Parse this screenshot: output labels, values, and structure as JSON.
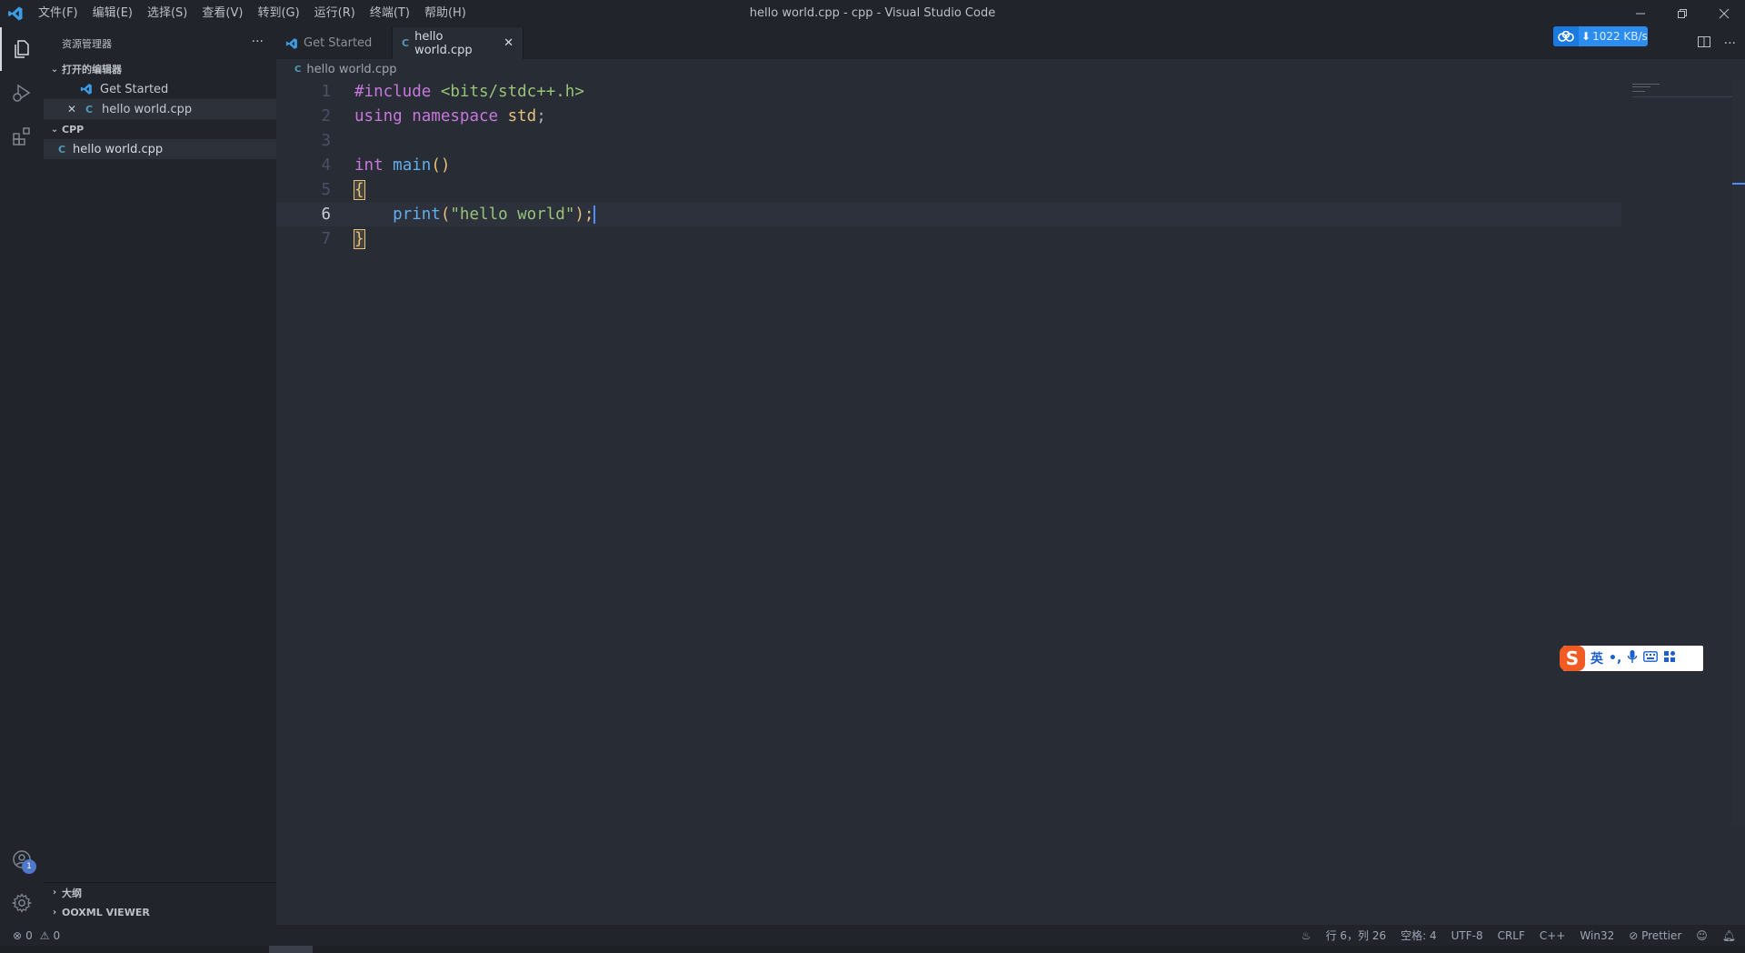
{
  "window": {
    "title": "hello world.cpp - cpp - Visual Studio Code",
    "menu": [
      "文件(F)",
      "编辑(E)",
      "选择(S)",
      "查看(V)",
      "转到(G)",
      "运行(R)",
      "终端(T)",
      "帮助(H)"
    ]
  },
  "activity_badge": "1",
  "sidebar": {
    "title": "资源管理器",
    "open_editors_title": "打开的编辑器",
    "open_editors": [
      "Get Started",
      "hello world.cpp"
    ],
    "folder_title": "CPP",
    "folder_items": [
      "hello world.cpp"
    ],
    "outline_title": "大纲",
    "ooxml_title": "OOXML VIEWER"
  },
  "tabs": [
    "Get Started",
    "hello world.cpp"
  ],
  "breadcrumb": "hello world.cpp",
  "code": {
    "line_numbers": [
      "1",
      "2",
      "3",
      "4",
      "5",
      "6",
      "7"
    ],
    "current_line": 6,
    "l1_a": "#include",
    "l1_b": " <bits/stdc++.h>",
    "l2_a": "using",
    "l2_b": " ",
    "l2_c": "namespace",
    "l2_d": " ",
    "l2_e": "std",
    "l2_f": ";",
    "l4_a": "int",
    "l4_b": " ",
    "l4_c": "main",
    "l4_d": "()",
    "l5_a": "{",
    "l6_indent": "    ",
    "l6_a": "print",
    "l6_b": "(",
    "l6_c": "\"hello world\"",
    "l6_d": ");",
    "l7_a": "}"
  },
  "statusbar": {
    "errors": "0",
    "warnings": "0",
    "position": "行 6，列 26",
    "spaces": "空格: 4",
    "encoding": "UTF-8",
    "eol": "CRLF",
    "language": "C++",
    "platform": "Win32",
    "formatter": "Prettier"
  },
  "overlays": {
    "netspeed": "1022 KB/s",
    "ime_lang": "英"
  },
  "colors": {
    "accent": "#528bff",
    "keyword": "#c678dd",
    "function": "#61afef",
    "string": "#98c379",
    "type": "#e5c07b"
  }
}
